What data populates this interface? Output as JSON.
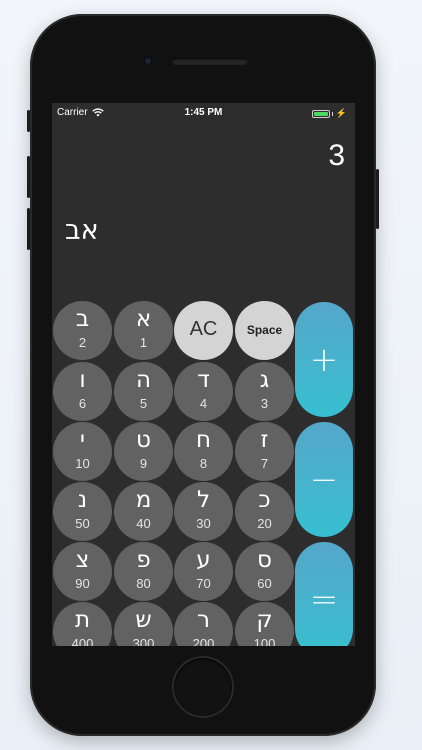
{
  "status_bar": {
    "carrier": "Carrier",
    "time": "1:45 PM",
    "battery_level": 1.0,
    "battery_color": "#4cd964",
    "wifi_icon": "wifi-icon",
    "battery_icon": "battery-icon",
    "charging_icon": "bolt-icon"
  },
  "display": {
    "result": "3",
    "input": "אב"
  },
  "keys": {
    "bet": {
      "letter": "ב",
      "value": "2"
    },
    "alef": {
      "letter": "א",
      "value": "1"
    },
    "vav": {
      "letter": "ו",
      "value": "6"
    },
    "he": {
      "letter": "ה",
      "value": "5"
    },
    "dalet": {
      "letter": "ד",
      "value": "4"
    },
    "gimel": {
      "letter": "ג",
      "value": "3"
    },
    "yod": {
      "letter": "י",
      "value": "10"
    },
    "tet": {
      "letter": "ט",
      "value": "9"
    },
    "het": {
      "letter": "ח",
      "value": "8"
    },
    "zayin": {
      "letter": "ז",
      "value": "7"
    },
    "nun": {
      "letter": "נ",
      "value": "50"
    },
    "mem": {
      "letter": "מ",
      "value": "40"
    },
    "lamed": {
      "letter": "ל",
      "value": "30"
    },
    "kaf": {
      "letter": "כ",
      "value": "20"
    },
    "tsadi": {
      "letter": "צ",
      "value": "90"
    },
    "pe": {
      "letter": "פ",
      "value": "80"
    },
    "ayin": {
      "letter": "ע",
      "value": "70"
    },
    "samekh": {
      "letter": "ס",
      "value": "60"
    },
    "tav": {
      "letter": "ת",
      "value": "400"
    },
    "shin": {
      "letter": "ש",
      "value": "300"
    },
    "resh": {
      "letter": "ר",
      "value": "200"
    },
    "qof": {
      "letter": "ק",
      "value": "100"
    }
  },
  "controls": {
    "clear_label": "AC",
    "space_label": "Space",
    "plus": "+",
    "minus": "−",
    "equals": "="
  },
  "colors": {
    "key_dark": "#626262",
    "key_light": "#d4d4d4",
    "operator_top": "#56a7c9",
    "operator_bottom": "#37bfd0",
    "screen_bg": "#2d2d2d"
  }
}
